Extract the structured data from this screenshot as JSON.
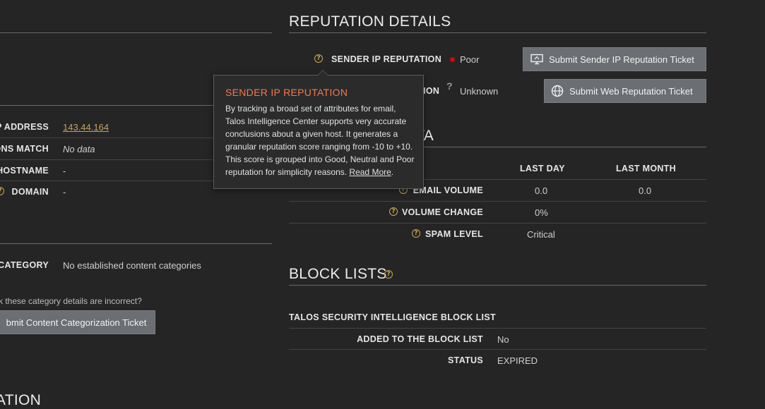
{
  "left": {
    "ip_address_label": "P ADDRESS",
    "ip_address_value": "143.44.164",
    "ons_match_label": "ONS MATCH",
    "ons_match_value": "No data",
    "hostname_label": "HOSTNAME",
    "hostname_value": "-",
    "domain_label": "DOMAIN",
    "domain_value": "-",
    "category_label": "CATEGORY",
    "category_value": "No established content categories",
    "category_question": "k these category details are incorrect?",
    "content_ticket_button": "bmit Content Categorization Ticket",
    "bottom_heading": "ATION"
  },
  "reputation": {
    "heading": "REPUTATION DETAILS",
    "sender_label": "SENDER IP REPUTATION",
    "sender_value": "Poor",
    "sender_button": "Submit Sender IP Reputation Ticket",
    "web_label": "WEB REPUTATION",
    "web_value": "Unknown",
    "web_button": "Submit Web Reputation Ticket"
  },
  "tooltip": {
    "title": "SENDER IP REPUTATION",
    "body": "By tracking a broad set of attributes for email, Talos Intelligence Center supports very accurate conclusions about a given host. It generates a granular reputation score ranging from -10 to +10. This score is grouped into Good, Neutral and Poor reputation for simplicity reasons.",
    "link": "Read More"
  },
  "email_data": {
    "heading_partial": "DATA",
    "col_last_day": "LAST DAY",
    "col_last_month": "LAST MONTH",
    "rows": [
      {
        "label": "EMAIL VOLUME",
        "last_day": "0.0",
        "last_month": "0.0"
      },
      {
        "label": "VOLUME CHANGE",
        "last_day": "0%",
        "last_month": ""
      },
      {
        "label": "SPAM LEVEL",
        "last_day": "Critical",
        "last_month": ""
      }
    ]
  },
  "block_lists": {
    "heading": "BLOCK LISTS",
    "list_name": "TALOS SECURITY INTELLIGENCE BLOCK LIST",
    "added_label": "ADDED TO THE BLOCK LIST",
    "added_value": "No",
    "status_label": "STATUS",
    "status_value": "EXPIRED"
  },
  "colors": {
    "background": "#252526",
    "accent_orange": "#f07b4a",
    "link_gold": "#c7a25a",
    "poor_red": "#c80c0c",
    "button_gray": "#6b6e73"
  }
}
